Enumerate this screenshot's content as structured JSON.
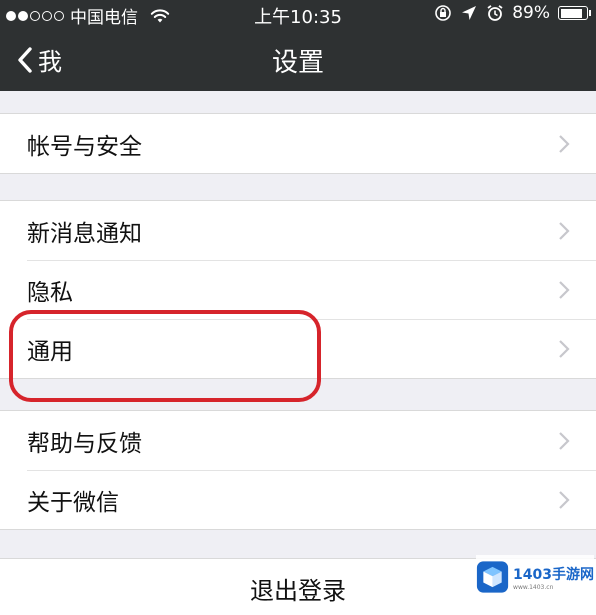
{
  "status_bar": {
    "signal_bars_filled": 2,
    "signal_bars_total": 5,
    "carrier": "中国电信",
    "time": "上午10:35",
    "battery_percent": "89%",
    "battery_level": 0.89
  },
  "nav": {
    "back_label": "我",
    "title": "设置"
  },
  "groups": {
    "account": [
      {
        "label": "帐号与安全"
      }
    ],
    "main": [
      {
        "label": "新消息通知"
      },
      {
        "label": "隐私"
      },
      {
        "label": "通用"
      }
    ],
    "help": [
      {
        "label": "帮助与反馈"
      },
      {
        "label": "关于微信"
      }
    ]
  },
  "logout": {
    "label": "退出登录"
  },
  "watermark": {
    "text": "1403手游网",
    "sub": "www.1403.cn"
  },
  "colors": {
    "header_bg": "#2e3132",
    "page_bg": "#efeff4",
    "highlight": "#d6242b",
    "chevron": "#c7c7cc"
  }
}
